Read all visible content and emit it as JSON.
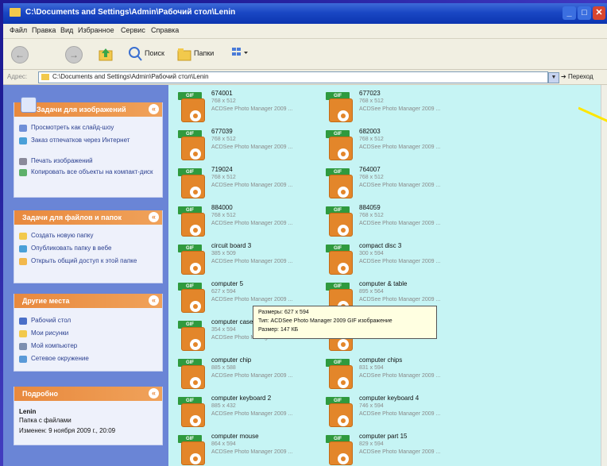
{
  "window": {
    "title": "C:\\Documents and Settings\\Admin\\Рабочий стол\\Lenin"
  },
  "menu": [
    "Файл",
    "Правка",
    "Вид",
    "Избранное",
    "Сервис",
    "Справка"
  ],
  "toolbar": {
    "search_label": "Поиск",
    "folders_label": "Папки"
  },
  "address": {
    "label": "Адрес:",
    "path": "C:\\Documents and Settings\\Admin\\Рабочий стол\\Lenin",
    "go_label": "Переход"
  },
  "sidebar": {
    "image_tasks": {
      "title": "Задачи для изображений",
      "items": [
        "Просмотреть как слайд-шоу",
        "Заказ отпечатков через Интернет",
        "Печать изображений",
        "Копировать все объекты на компакт-диск"
      ]
    },
    "file_tasks": {
      "title": "Задачи для файлов и папок",
      "items": [
        "Создать новую папку",
        "Опубликовать папку в вебе",
        "Открыть общий доступ к этой папке"
      ]
    },
    "other_places": {
      "title": "Другие места",
      "items": [
        "Рабочий стол",
        "Мои рисунки",
        "Мой компьютер",
        "Сетевое окружение"
      ]
    },
    "details": {
      "title": "Подробно",
      "name": "Lenin",
      "type": "Папка с файлами",
      "modified": "Изменен: 9 ноября 2009 г., 20:09"
    }
  },
  "files": [
    {
      "name": "674001",
      "dims": "768 x 512",
      "app": "ACDSee Photo Manager 2009 ..."
    },
    {
      "name": "677023",
      "dims": "768 x 512",
      "app": "ACDSee Photo Manager 2009 ..."
    },
    {
      "name": "677039",
      "dims": "768 x 512",
      "app": "ACDSee Photo Manager 2009 ..."
    },
    {
      "name": "682003",
      "dims": "768 x 512",
      "app": "ACDSee Photo Manager 2009 ..."
    },
    {
      "name": "719024",
      "dims": "768 x 512",
      "app": "ACDSee Photo Manager 2009 ..."
    },
    {
      "name": "764007",
      "dims": "768 x 512",
      "app": "ACDSee Photo Manager 2009 ..."
    },
    {
      "name": "884000",
      "dims": "768 x 512",
      "app": "ACDSee Photo Manager 2009 ..."
    },
    {
      "name": "884059",
      "dims": "768 x 512",
      "app": "ACDSee Photo Manager 2009 ..."
    },
    {
      "name": "circuit board 3",
      "dims": "385 x 509",
      "app": "ACDSee Photo Manager 2009 ..."
    },
    {
      "name": "compact disc 3",
      "dims": "300 x 594",
      "app": "ACDSee Photo Manager 2009 ..."
    },
    {
      "name": "computer 5",
      "dims": "627 x 594",
      "app": "ACDSee Photo Manager 2009 ..."
    },
    {
      "name": "computer & table",
      "dims": "895 x 564",
      "app": "ACDSee Photo Manager 2009 ..."
    },
    {
      "name": "computer case",
      "dims": "354 x 594",
      "app": "ACDSee Photo Manager 2009 ..."
    },
    {
      "name": "computer",
      "dims": "",
      "app": ""
    },
    {
      "name": "computer chip",
      "dims": "885 x 588",
      "app": "ACDSee Photo Manager 2009 ..."
    },
    {
      "name": "computer chips",
      "dims": "831 x 594",
      "app": "ACDSee Photo Manager 2009 ..."
    },
    {
      "name": "computer keyboard 2",
      "dims": "885 x 432",
      "app": "ACDSee Photo Manager 2009 ..."
    },
    {
      "name": "computer keyboard 4",
      "dims": "746 x 594",
      "app": "ACDSee Photo Manager 2009 ..."
    },
    {
      "name": "computer mouse",
      "dims": "864 x 594",
      "app": "ACDSee Photo Manager 2009 ..."
    },
    {
      "name": "computer part 15",
      "dims": "829 x 594",
      "app": "ACDSee Photo Manager 2009 ..."
    }
  ],
  "tooltip": {
    "line1": "Размеры: 627 x 594",
    "line2": "Тип: ACDSee Photo Manager 2009 GIF изображение",
    "line3": "Размер: 147 КБ"
  },
  "icons": {
    "file_type": "GIF",
    "window_controls": [
      "minimize-icon",
      "maximize-icon",
      "close-icon"
    ]
  },
  "colors": {
    "content_bg": "#c6f4f4",
    "panel_header": "#e8893e",
    "titlebar": "#1a47c4"
  }
}
